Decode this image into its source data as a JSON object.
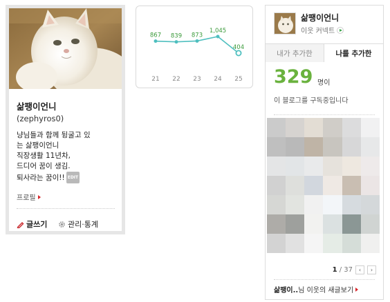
{
  "profile": {
    "nickname": "삶팽이언니",
    "blog_id": "(zephyros0)",
    "intro_lines": [
      "냥님들과 함께 뒹굴고 있",
      "는 삶팽이언니",
      "직장생활 11년차,",
      "드디어 꿈이 생김.",
      "퇴사라는 꿈이!!"
    ],
    "edit_badge": "EDIT",
    "profile_link": "프로필",
    "write_label": "글쓰기",
    "manage_label": "관리·통계"
  },
  "visitor_chart": {
    "chart_data": {
      "type": "line",
      "categories": [
        "21",
        "22",
        "23",
        "24",
        "25"
      ],
      "values": [
        867,
        839,
        873,
        1045,
        404
      ],
      "data_labels": [
        "867",
        "839",
        "873",
        "1,045",
        "404"
      ],
      "title": "",
      "xlabel": "",
      "ylabel": "",
      "grid": false,
      "colors": {
        "line": "#4fbfbf",
        "label": "#3a9a3a",
        "tick": "#888888"
      }
    }
  },
  "neighbors": {
    "name": "삶팽이언니",
    "sub_label": "이웃 커넥트",
    "tabs": [
      "내가 추가한",
      "나를 추가한"
    ],
    "active_tab": 1,
    "count": "329",
    "count_unit": "명이",
    "count_caption": "이 블로그를 구독중입니다",
    "mosaic_colors": [
      "#cbcbcb",
      "#d6d3d0",
      "#e3ddd4",
      "#d0cdc8",
      "#dcdcdd",
      "#f1f1f2",
      "#bfbfbf",
      "#b9b9b9",
      "#bfb4a6",
      "#c8c5bf",
      "#d7d7d8",
      "#e7e8e9",
      "#e4e5e6",
      "#e2e5e7",
      "#e9eaeb",
      "#e6e2dc",
      "#eee8e0",
      "#eeeaea",
      "#d1d1d1",
      "#dedfdc",
      "#d2d7de",
      "#efe9e4",
      "#c9beb2",
      "#ebe5e5",
      "#d6d7d4",
      "#e2e4e0",
      "#f1f1f1",
      "#f3f6f9",
      "#d6dbdf",
      "#d4d8da",
      "#aeaca8",
      "#9ea09d",
      "#f2f2f0",
      "#dbe1e1",
      "#8b9795",
      "#d0d4d2",
      "#d3d3d3",
      "#e1e1e1",
      "#f5f5f5",
      "#e5ece6",
      "#d5ddd8",
      "#f0f0ef"
    ],
    "pager": {
      "current": "1",
      "total": "37",
      "prev": "‹",
      "next": "›"
    },
    "footer_name": "삶팽이..",
    "footer_text": "님 이웃의 새글보기"
  },
  "icons": [
    "pencil-icon",
    "gear-icon",
    "caret-right-icon",
    "green-arrow-circle-icon",
    "prev-page-icon",
    "next-page-icon"
  ]
}
